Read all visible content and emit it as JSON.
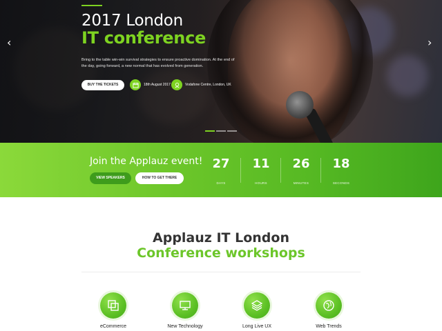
{
  "hero": {
    "title_line1": "2017 London",
    "title_line2": "IT conference",
    "description": "Bring to the table win-win survival strategies to ensure proactive domination. At the end of the day, going forward, a new normal that has evolved from generation.",
    "buy_button": "BUY THE TICKETS",
    "date_text": "18th August 2017",
    "location_text": "Vodafone Centre, London, UK",
    "prev_arrow": "‹",
    "next_arrow": "›",
    "active_slide": 1,
    "slide_count": 3
  },
  "event_band": {
    "heading": "Join the Applauz event!",
    "speakers_button": "VIEW SPEAKERS",
    "directions_button": "HOW TO GET THERE",
    "countdown": [
      {
        "value": "27",
        "unit": "DAYS"
      },
      {
        "value": "11",
        "unit": "HOURS"
      },
      {
        "value": "26",
        "unit": "MINUTES"
      },
      {
        "value": "18",
        "unit": "SECONDS"
      }
    ]
  },
  "workshops": {
    "title_line1": "Applauz IT London",
    "title_line2": "Conference workshops",
    "items": [
      {
        "label": "eCommerce",
        "icon": "overlapping-squares-icon"
      },
      {
        "label": "New Technology",
        "icon": "monitor-icon"
      },
      {
        "label": "Long Live UX",
        "icon": "layers-icon"
      },
      {
        "label": "Web Trends",
        "icon": "globe-icon"
      }
    ]
  },
  "colors": {
    "accent": "#7ed321",
    "band_start": "#8bd93a",
    "band_end": "#3ea51c",
    "hero_dark": "#1b1c1f"
  }
}
